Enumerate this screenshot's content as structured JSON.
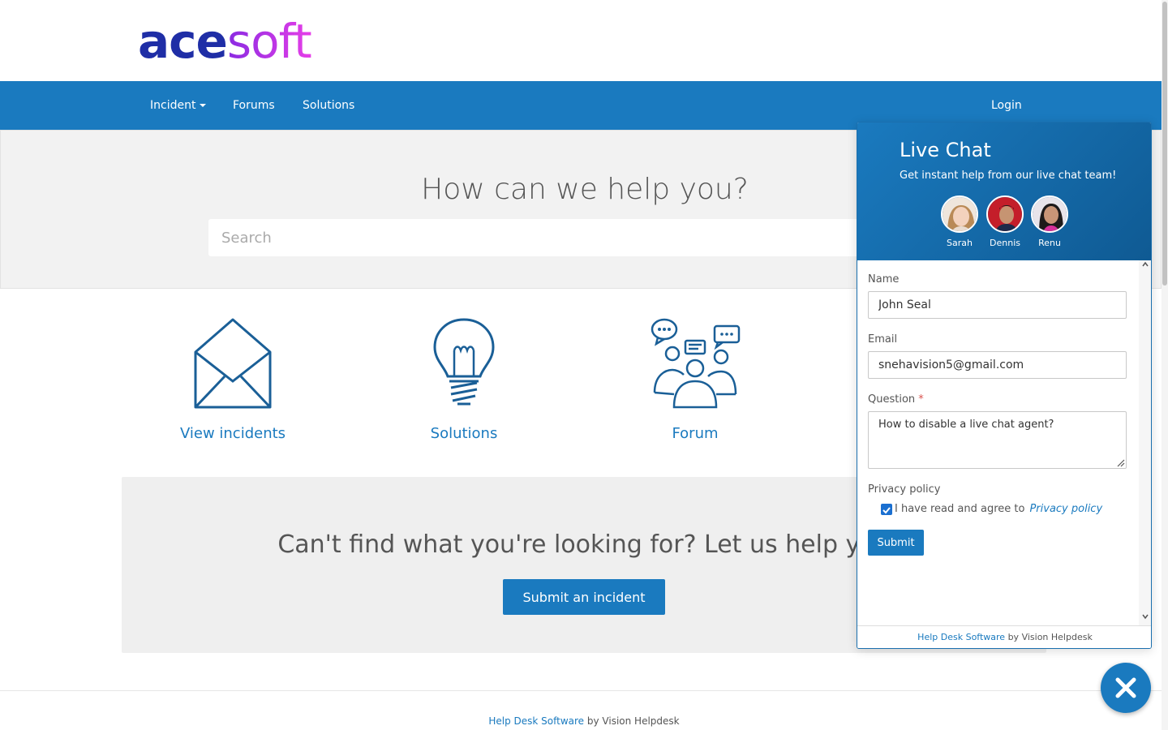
{
  "brand": {
    "logo_part1": "ace",
    "logo_part2": "soft"
  },
  "nav": {
    "incident": "Incident",
    "forums": "Forums",
    "solutions": "Solutions",
    "login": "Login"
  },
  "hero": {
    "title": "How can we help you?",
    "search_placeholder": "Search"
  },
  "tiles": [
    {
      "label": "View incidents",
      "icon": "envelope-icon"
    },
    {
      "label": "Solutions",
      "icon": "lightbulb-icon"
    },
    {
      "label": "Forum",
      "icon": "forum-people-icon"
    }
  ],
  "cta": {
    "title": "Can't find what you're looking for? Let us help you",
    "button": "Submit an incident"
  },
  "footer": {
    "link": "Help Desk Software",
    "suffix": " by Vision Helpdesk"
  },
  "chat": {
    "title": "Live Chat",
    "subtitle": "Get instant help from our live chat team!",
    "agents": [
      "Sarah",
      "Dennis",
      "Renu"
    ],
    "name_label": "Name",
    "name_value": "John Seal",
    "email_label": "Email",
    "email_value": "snehavision5@gmail.com",
    "question_label": "Question",
    "required_mark": "*",
    "question_value": "How to disable a live chat agent?",
    "privacy_label": "Privacy policy",
    "agree_text": "I have read and agree to",
    "privacy_link": "Privacy policy",
    "agree_checked": true,
    "submit": "Submit",
    "footer_link": "Help Desk Software",
    "footer_suffix": " by Vision Helpdesk"
  },
  "colors": {
    "primary": "#1a7abf",
    "nav": "#1a7abf",
    "logo_dark": "#1f2ea6",
    "logo_accent": "#c23bd6"
  }
}
